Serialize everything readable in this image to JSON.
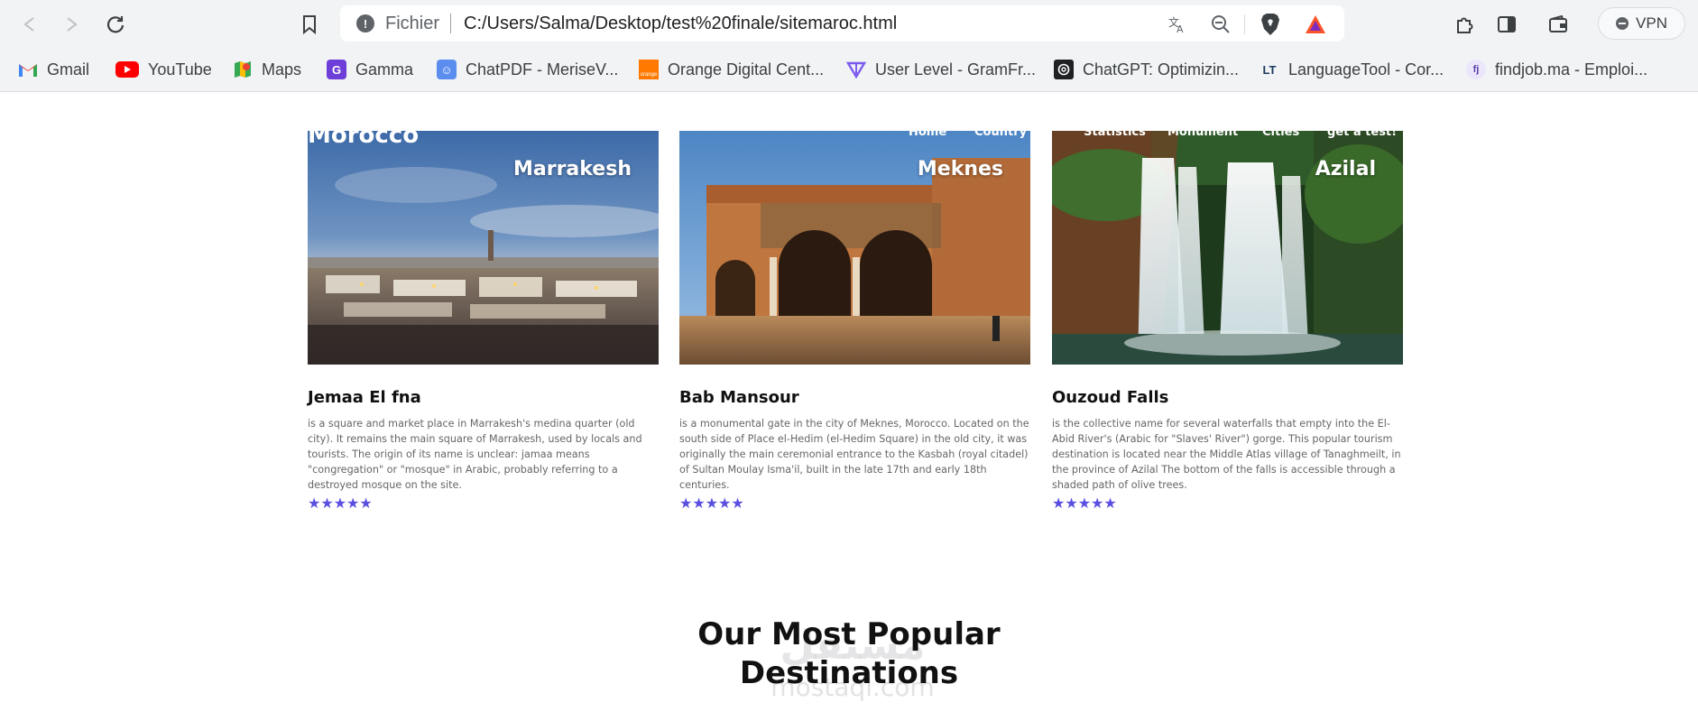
{
  "browser": {
    "scheme_label": "Fichier",
    "url": "C:/Users/Salma/Desktop/test%20finale/sitemaroc.html",
    "vpn_label": "VPN",
    "bookmarks": [
      {
        "label": "Gmail"
      },
      {
        "label": "YouTube"
      },
      {
        "label": "Maps"
      },
      {
        "label": "Gamma"
      },
      {
        "label": "ChatPDF - MeriseV..."
      },
      {
        "label": "Orange Digital Cent..."
      },
      {
        "label": "User Level - GramFr..."
      },
      {
        "label": "ChatGPT: Optimizin..."
      },
      {
        "label": "LanguageTool - Cor..."
      },
      {
        "label": "findjob.ma - Emploi..."
      }
    ],
    "bookmark_icon_text": {
      "orange": "orange",
      "languagetool": "LT",
      "findjob": "fj"
    }
  },
  "header_overlay": {
    "logo": "Morocco",
    "nav": [
      "Home",
      "Country I",
      "Statistics",
      "Monument",
      "Cities",
      "get a test!"
    ]
  },
  "cards": [
    {
      "city": "Marrakesh",
      "title": "Jemaa El fna",
      "description": "is a square and market place in Marrakesh's medina quarter (old city). It remains the main square of Marrakesh, used by locals and tourists. The origin of its name is unclear: jamaa means \"congregation\" or \"mosque\" in Arabic, probably referring to a destroyed mosque on the site.",
      "rating": "★★★★★"
    },
    {
      "city": "Meknes",
      "title": "Bab Mansour",
      "description": "is a monumental gate in the city of Meknes, Morocco. Located on the south side of Place el-Hedim (el-Hedim Square) in the old city, it was originally the main ceremonial entrance to the Kasbah (royal citadel) of Sultan Moulay Isma'il, built in the late 17th and early 18th centuries.",
      "rating": "★★★★★"
    },
    {
      "city": "Azilal",
      "title": "Ouzoud Falls",
      "description": "is the collective name for several waterfalls that empty into the El-Abid River's (Arabic for \"Slaves' River\") gorge. This popular tourism destination is located near the Middle Atlas village of Tanaghmeilt, in the province of Azilal The bottom of the falls is accessible through a shaded path of olive trees.",
      "rating": "★★★★★"
    }
  ],
  "section": {
    "title_line1": "Our Most Popular",
    "title_line2": "Destinations"
  },
  "watermark": {
    "line1": "مستقل",
    "line2": "mostaql.com"
  },
  "colors": {
    "star": "#5b4fe0",
    "gmail_red": "#ea4335",
    "youtube_red": "#ff0000",
    "orange": "#ff7900"
  }
}
